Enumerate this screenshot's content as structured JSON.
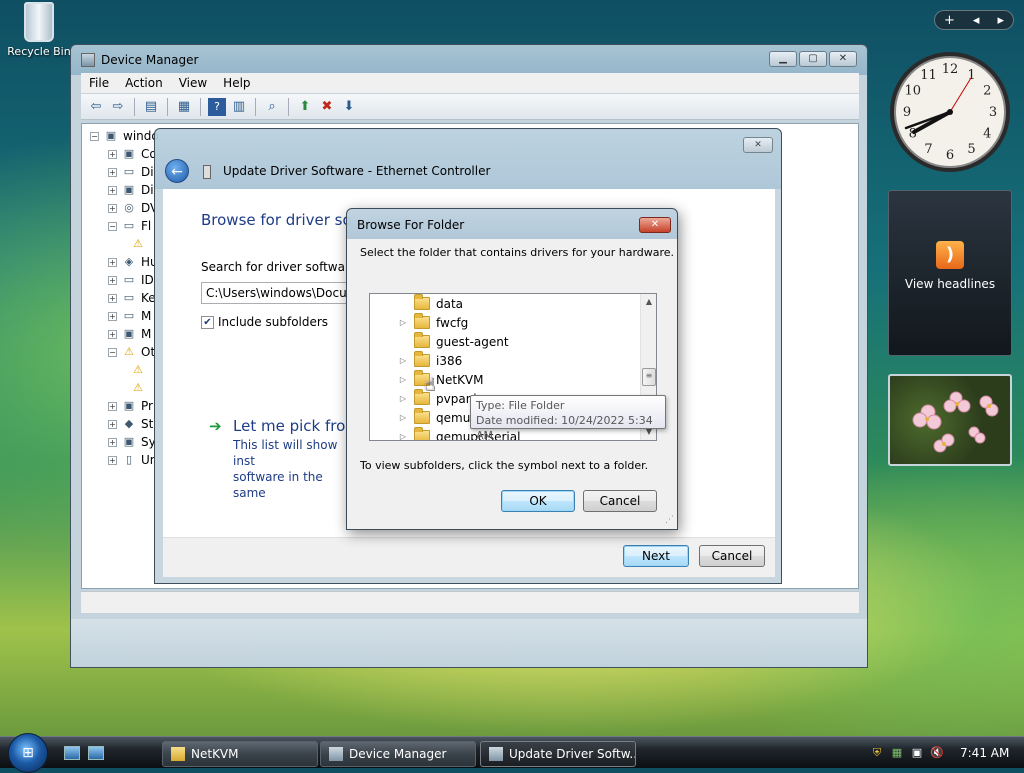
{
  "desktop": {
    "recycle_bin_label": "Recycle Bin"
  },
  "sidebar": {
    "control_add": "+",
    "control_prev": "◂",
    "control_next": "▸",
    "feed_gadget_label": "View headlines",
    "clock_numbers": [
      "12",
      "1",
      "2",
      "3",
      "4",
      "5",
      "6",
      "7",
      "8",
      "9",
      "10",
      "11"
    ]
  },
  "device_manager": {
    "title": "Device Manager",
    "menu": [
      "File",
      "Action",
      "View",
      "Help"
    ],
    "tree_root": "windo",
    "tree_items": [
      "Co",
      "Di",
      "Di",
      "DV",
      "Fl",
      "",
      "Hu",
      "ID",
      "Ke",
      "M",
      "M",
      "Ot",
      "",
      "",
      "Pr",
      "St",
      "Sy",
      "Ur"
    ]
  },
  "update_driver": {
    "title": "Update Driver Software - Ethernet Controller",
    "heading": "Browse for driver sof",
    "search_label": "Search for driver software in",
    "path_value": "C:\\Users\\windows\\Docum",
    "include_subfolders_label": "Include subfolders",
    "include_subfolders_checked": true,
    "pick_title": "Let me pick from",
    "pick_desc_line1": "This list will show inst",
    "pick_desc_line2": "software in the same",
    "next_label": "Next",
    "cancel_label": "Cancel"
  },
  "browse_folder": {
    "title": "Browse For Folder",
    "instruction": "Select the folder that contains drivers for your hardware.",
    "folders": [
      {
        "name": "data",
        "expandable": false
      },
      {
        "name": "fwcfg",
        "expandable": true
      },
      {
        "name": "guest-agent",
        "expandable": false
      },
      {
        "name": "i386",
        "expandable": true
      },
      {
        "name": "NetKVM",
        "expandable": true
      },
      {
        "name": "pvpanic",
        "expandable": true
      },
      {
        "name": "qemufwcfg",
        "expandable": true
      },
      {
        "name": "qemupciserial",
        "expandable": true
      }
    ],
    "tooltip_line1": "Type: File Folder",
    "tooltip_line2": "Date modified: 10/24/2022 5:34 AM",
    "hint": "To view subfolders, click the symbol next to a folder.",
    "ok_label": "OK",
    "cancel_label": "Cancel"
  },
  "taskbar": {
    "tasks": [
      {
        "label": "NetKVM",
        "active": false
      },
      {
        "label": "Device Manager",
        "active": false
      },
      {
        "label": "Update Driver Softw...",
        "active": true
      }
    ],
    "time": "7:41 AM"
  }
}
